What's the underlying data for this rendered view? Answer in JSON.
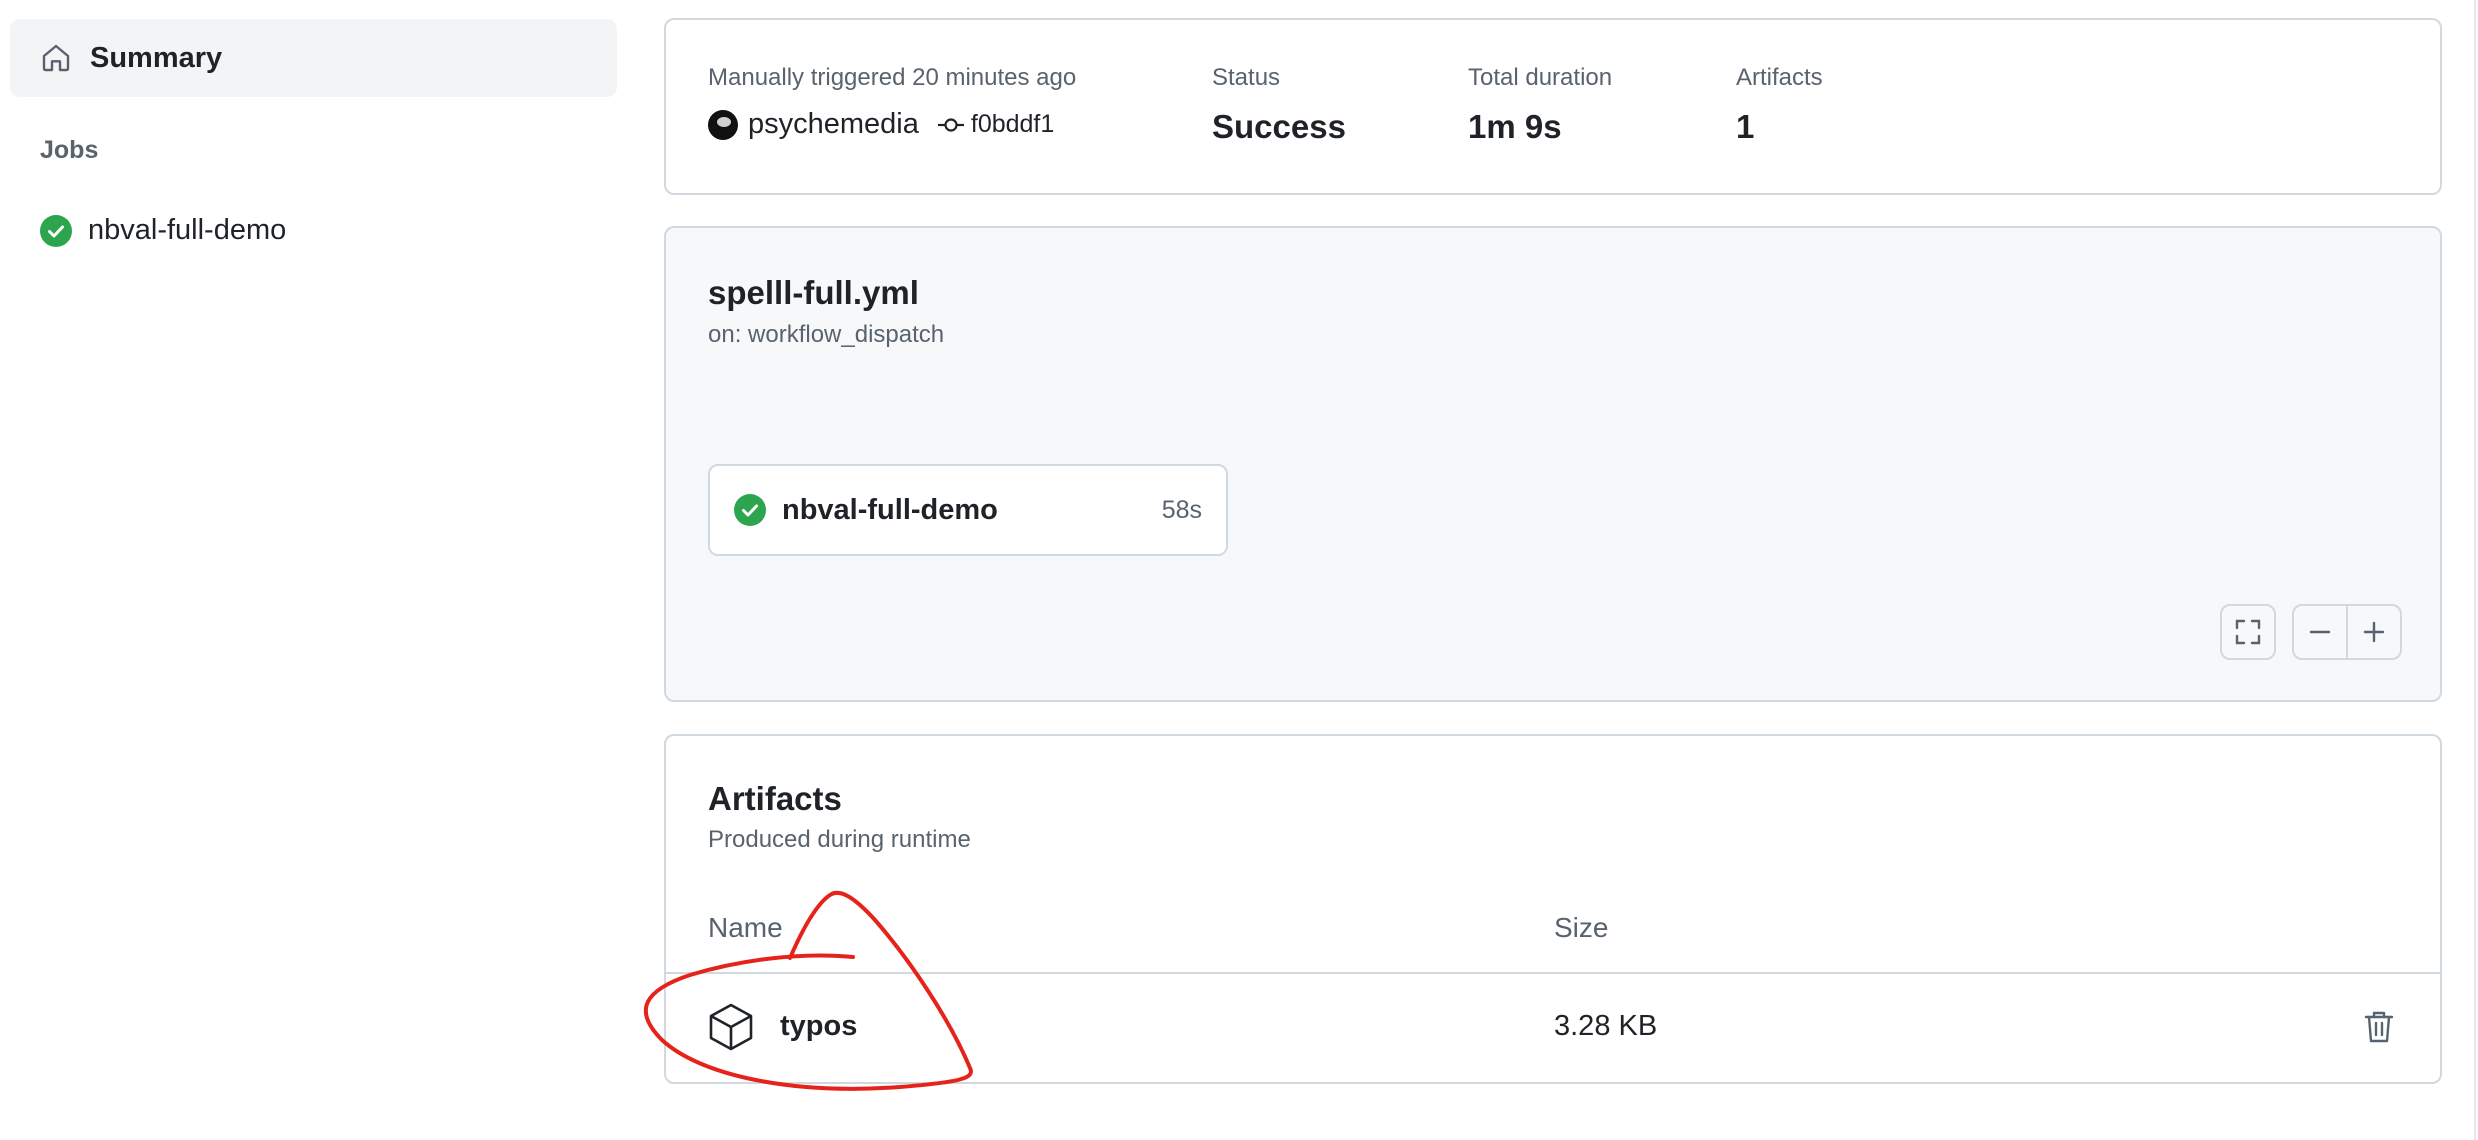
{
  "sidebar": {
    "summary_label": "Summary",
    "jobs_heading": "Jobs",
    "jobs": [
      {
        "label": "nbval-full-demo",
        "status": "success"
      }
    ]
  },
  "run": {
    "trigger_text": "Manually triggered 20 minutes ago",
    "actor": "psychemedia",
    "commit": "f0bddf1",
    "status_label": "Status",
    "status_value": "Success",
    "duration_label": "Total duration",
    "duration_value": "1m 9s",
    "artifacts_label": "Artifacts",
    "artifacts_value": "1"
  },
  "workflow": {
    "file": "spelll-full.yml",
    "trigger": "on: workflow_dispatch",
    "job": {
      "name": "nbval-full-demo",
      "duration": "58s"
    }
  },
  "artifacts": {
    "title": "Artifacts",
    "subtitle": "Produced during runtime",
    "columns": {
      "name": "Name",
      "size": "Size"
    },
    "rows": [
      {
        "name": "typos",
        "size": "3.28 KB"
      }
    ]
  },
  "colors": {
    "success": "#1a7f37",
    "annotation": "#e5231b",
    "border": "#d1d9e0",
    "muted_text": "#59636e"
  },
  "icons": [
    "home-icon",
    "check-circle-icon",
    "git-commit-icon",
    "screen-full-icon",
    "zoom-out-icon",
    "zoom-in-icon",
    "package-icon",
    "trash-icon"
  ]
}
